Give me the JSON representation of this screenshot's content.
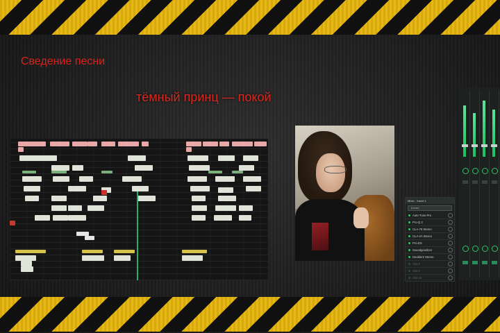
{
  "slide": {
    "title": "Сведение песни",
    "subtitle": "тёмный принц — покой"
  },
  "colors": {
    "title": "#e0201a",
    "hazard_yellow": "#e8b810",
    "playhead": "#1fb36b",
    "meter": "#18c060"
  },
  "plugin_panel": {
    "header": "Mixer - Insert 1",
    "preset": "(none)",
    "slots": [
      {
        "name": "Auto-Tune Pro",
        "active": true
      },
      {
        "name": "Pro-Q 3",
        "active": true
      },
      {
        "name": "CLA-76 Stereo",
        "active": true
      },
      {
        "name": "CLA-2A Stereo",
        "active": true
      },
      {
        "name": "Pro-DS",
        "active": true
      },
      {
        "name": "Soundgoodizer",
        "active": true
      },
      {
        "name": "Doubler2 Stereo",
        "active": true
      },
      {
        "name": "Slot 8",
        "active": false
      },
      {
        "name": "Slot 9",
        "active": false
      },
      {
        "name": "Slot 10",
        "active": false
      }
    ]
  },
  "mixer": {
    "channel_levels": [
      0.82,
      0.7,
      0.9,
      0.75
    ]
  },
  "photo": {
    "icon": "person-photo"
  }
}
